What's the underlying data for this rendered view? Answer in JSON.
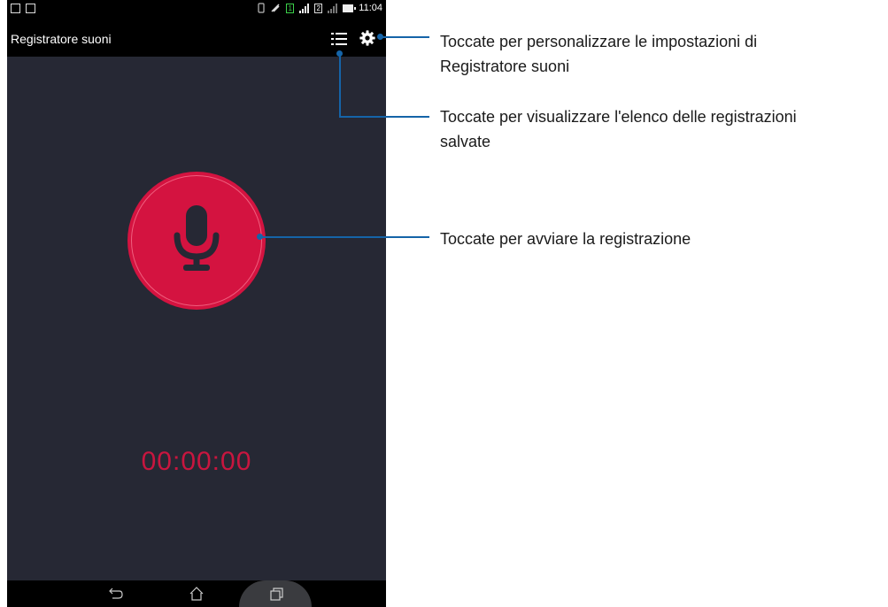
{
  "status_bar": {
    "time": "11:04",
    "sim1": "1",
    "sim2": "2",
    "icons": [
      "calendar-icon",
      "image-icon",
      "vibrate-icon",
      "mute-icon",
      "signal-icon",
      "battery-icon"
    ]
  },
  "app_bar": {
    "title": "Registratore suoni",
    "list_icon": "list-icon",
    "settings_icon": "gear-icon"
  },
  "main": {
    "record_icon": "microphone-icon",
    "timer": "00:00:00"
  },
  "nav_bar": {
    "icons": [
      "back-icon",
      "home-icon",
      "recent-apps-icon"
    ]
  },
  "callouts": {
    "settings_line1": "Toccate per personalizzare le impostazioni di",
    "settings_line2": "Registratore suoni",
    "list_line1": "Toccate per visualizzare l'elenco delle registrazioni",
    "list_line2": "salvate",
    "record": "Toccate per avviare la registrazione"
  },
  "colors": {
    "screen_bg": "#262834",
    "bar_bg": "#000000",
    "record_red": "#d41340",
    "timer_red": "#c8163f",
    "callout_blue": "#1564a8"
  }
}
